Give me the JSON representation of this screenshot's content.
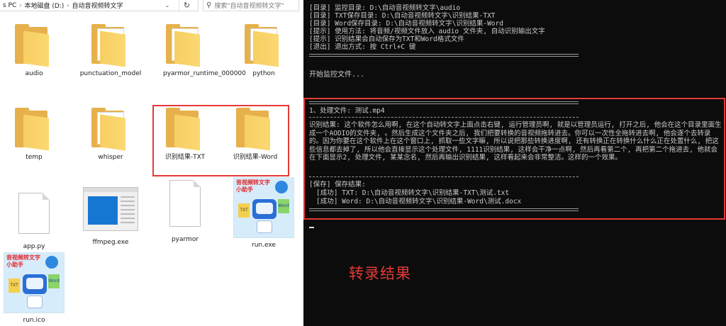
{
  "explorer": {
    "breadcrumb": [
      "s PC",
      "本地磁盘 (D:)",
      "自动音视频转文字"
    ],
    "search_placeholder": "搜索\"自动音视频转文字\"",
    "items": [
      {
        "name": "audio",
        "type": "folder"
      },
      {
        "name": "punctuation_model",
        "type": "folder-doc"
      },
      {
        "name": "pyarmor_runtime_000000",
        "type": "folder-doc"
      },
      {
        "name": "python",
        "type": "folder-doc"
      },
      {
        "name": "temp",
        "type": "folder"
      },
      {
        "name": "whisper",
        "type": "folder-doc"
      },
      {
        "name": "识别结果-TXT",
        "type": "folder"
      },
      {
        "name": "识别结果-Word",
        "type": "folder"
      },
      {
        "name": "app.py",
        "type": "file"
      },
      {
        "name": "ffmpeg.exe",
        "type": "exe"
      },
      {
        "name": "pyarmor",
        "type": "file"
      },
      {
        "name": "run.exe",
        "type": "app"
      },
      {
        "name": "run.ico",
        "type": "app"
      }
    ],
    "app_thumb_title": "音视频转文字小助手",
    "app_thumb_txt": "TXT",
    "app_thumb_word": "Word"
  },
  "console": {
    "header_lines": [
      "[目录] 监控目录: D:\\自动音视频转文字\\audio",
      "[目录] TXT保存目录: D:\\自动音视频转文字\\识别结果-TXT",
      "[目录] Word保存目录: D:\\自动音视频转文字\\识别结果-Word",
      "[提示] 使用方法: 将音频/视频文件放入 audio 文件夹, 自动识别输出文字",
      "[提示] 识别结果会自动保存为TXT和Word格式文件",
      "[退出] 退出方式: 按 Ctrl+C 键"
    ],
    "start_monitor": "开始监控文件...",
    "process_line": "1、处理文件: 测试.mp4",
    "result_text": "识别结果: 这个软件怎么用啊, 在这个自动转文字上面点击右键, 运行管理员啊, 就是以管理员运行, 打开之后, 他会在这个目录里面生成一个AODIO的文件夹, 。然后生成这个文件夹之后, 我们把要转换的音视频拖转进去。你可以一次性全拖转进去啊, 他会逐个去转录的。因为你要在这个软件上在这个窗口上, 抓取一些文字嘛, 所以说把那些转换进度啊, 还有转换正在转换什么什么正在处置什么, 把这些信息都去掉了, 所以他会直接显示这个处理文件, 1111识别结果, 这样会干净一点啊, 然后再看第二个, 再把第二个拖进去, 他就会在下面显示2, 处理文件, 某某念名, 然后再输出识别结果, 这样看起来会非常整洁。这样的一个效果。",
    "save_title": "[保存] 保存结果:",
    "save_txt": "[成功] TXT: D:\\自动音视频转文字\\识别结果-TXT\\测试.txt",
    "save_word": "[成功] Word: D:\\自动音视频转文字\\识别结果-Word\\测试.docx",
    "caption": "转录结果"
  }
}
